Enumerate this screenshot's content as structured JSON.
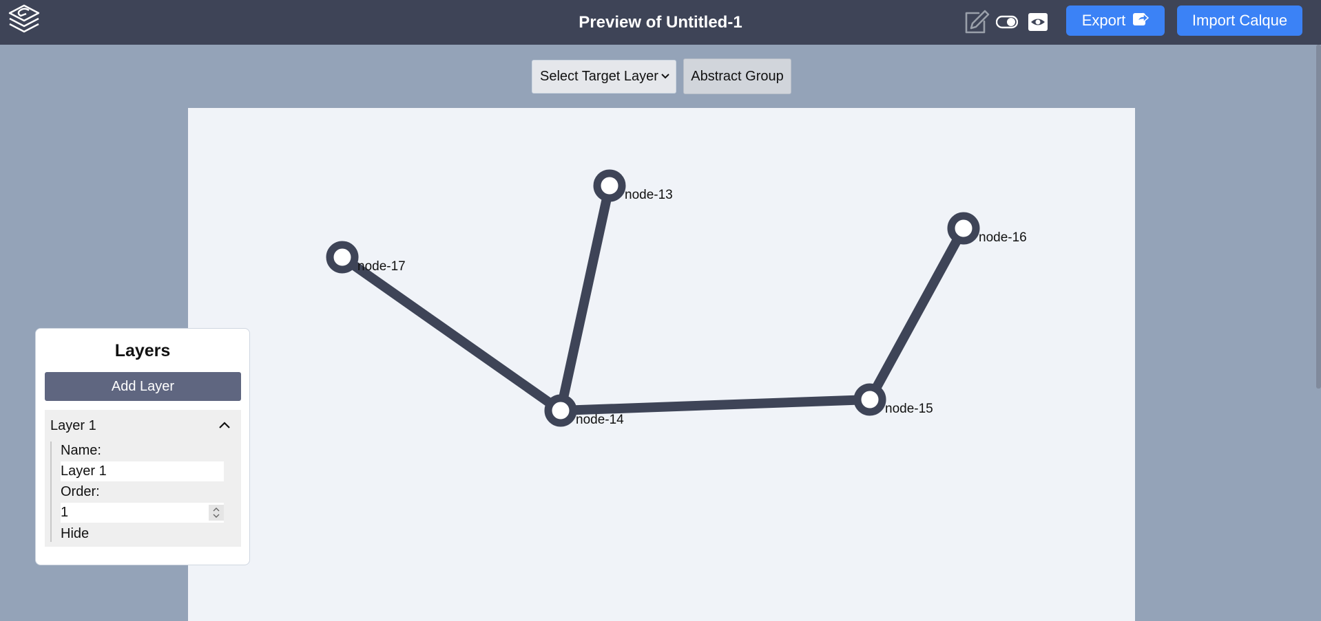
{
  "header": {
    "title_prefix": "Preview of",
    "title_name": "Untitled-1",
    "export_label": "Export",
    "import_label": "Import Calque"
  },
  "toolbar": {
    "select_label": "Select Target Layer",
    "abstract_group_label": "Abstract Group"
  },
  "graph": {
    "nodes": [
      {
        "id": "node-13",
        "label": "node-13"
      },
      {
        "id": "node-14",
        "label": "node-14"
      },
      {
        "id": "node-15",
        "label": "node-15"
      },
      {
        "id": "node-16",
        "label": "node-16"
      },
      {
        "id": "node-17",
        "label": "node-17"
      }
    ],
    "edges": [
      [
        "node-17",
        "node-14"
      ],
      [
        "node-13",
        "node-14"
      ],
      [
        "node-14",
        "node-15"
      ],
      [
        "node-15",
        "node-16"
      ]
    ],
    "edge_color": "#3e4457"
  },
  "layers_panel": {
    "title": "Layers",
    "add_layer_label": "Add Layer",
    "items": [
      {
        "header": "Layer 1",
        "name_label": "Name:",
        "name_value": "Layer 1",
        "order_label": "Order:",
        "order_value": "1",
        "hide_label": "Hide"
      }
    ]
  },
  "colors": {
    "topbar": "#3e4457",
    "accent": "#3b82f6",
    "background": "#94a3b8",
    "canvas": "#f0f3f8"
  }
}
